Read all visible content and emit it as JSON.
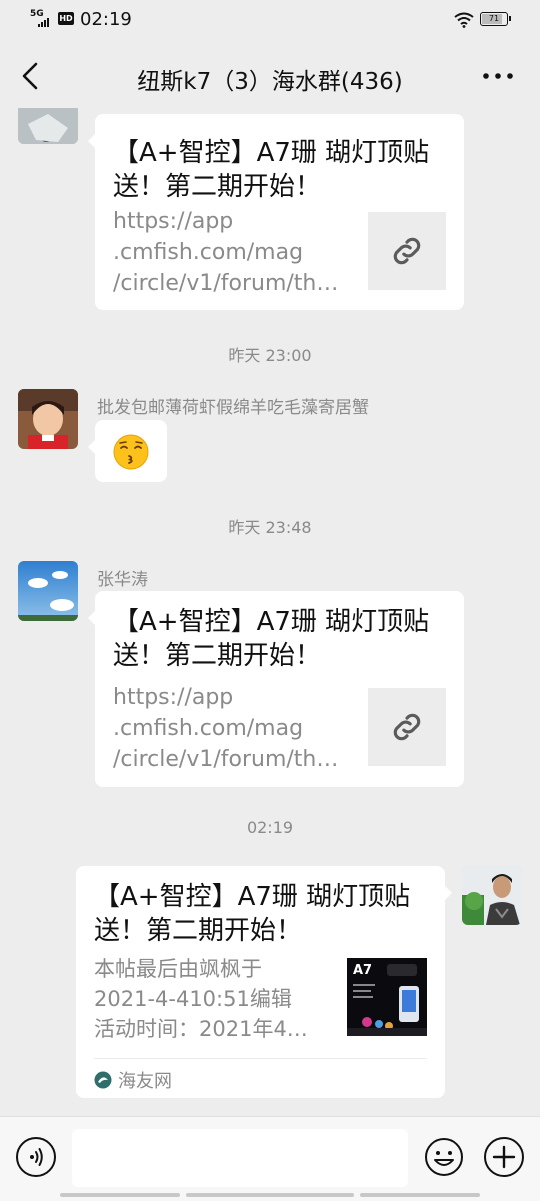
{
  "status_bar": {
    "network": "5G",
    "hd": "HD",
    "time": "02:19",
    "battery": "71"
  },
  "nav": {
    "title": "纽斯k7（3）海水群(436)",
    "back_icon": "chevron-left-icon",
    "more_icon": "ellipsis-icon"
  },
  "messages": [
    {
      "type": "link_card",
      "title": "【A+智控】A7珊 瑚灯顶贴送！第二期开始！",
      "url_lines": [
        "https://app",
        ".cmfish.com/mag",
        "/circle/v1/forum/th…"
      ],
      "thumb_icon": "link-icon"
    },
    {
      "type": "time",
      "text": "昨天 23:00"
    },
    {
      "type": "emoji",
      "sender": "批发包邮薄荷虾假绵羊吃毛藻寄居蟹",
      "emoji": "kissing-face-icon"
    },
    {
      "type": "time",
      "text": "昨天 23:48"
    },
    {
      "type": "link_card",
      "sender": "张华涛",
      "title": "【A+智控】A7珊 瑚灯顶贴送！第二期开始！",
      "url_lines": [
        "https://app",
        ".cmfish.com/mag",
        "/circle/v1/forum/th…"
      ],
      "thumb_icon": "link-icon"
    },
    {
      "type": "time",
      "text": "02:19"
    },
    {
      "type": "article_card",
      "title": "【A+智控】A7珊 瑚灯顶贴送！第二期开始！",
      "desc_lines": [
        "本帖最后由飒枫于",
        "2021-4-410:51编辑",
        "活动时间：2021年4…"
      ],
      "image_label": "A7",
      "source": "海友网"
    }
  ],
  "input_bar": {
    "voice_icon": "voice-icon",
    "emoji_icon": "smiley-icon",
    "plus_icon": "plus-icon"
  },
  "colors": {
    "background": "#ededed",
    "bubble": "#ffffff",
    "muted_text": "#8a8a8a"
  }
}
